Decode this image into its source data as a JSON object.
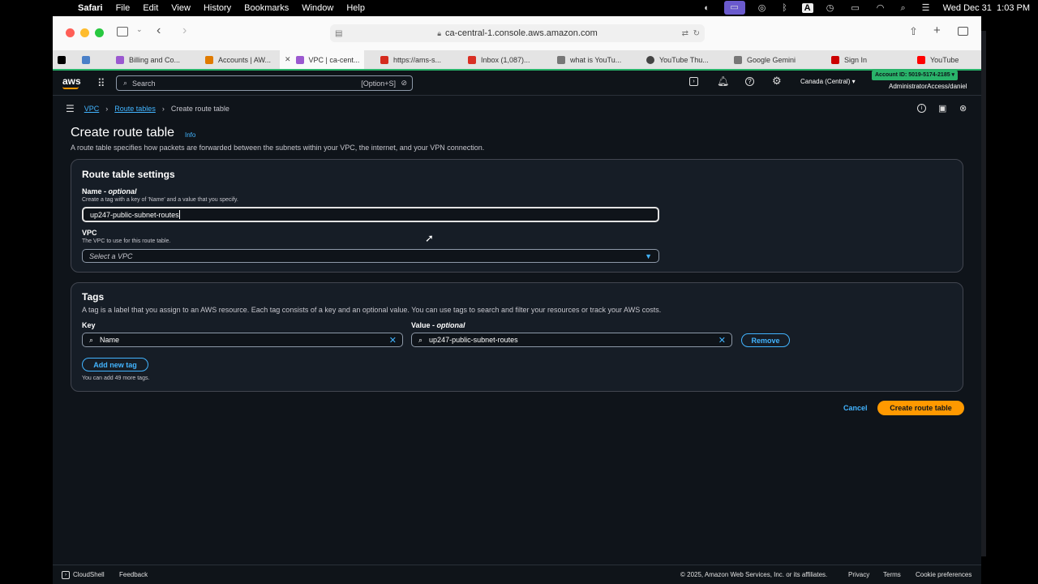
{
  "menubar": {
    "apple": "",
    "app": "Safari",
    "items": [
      "File",
      "Edit",
      "View",
      "History",
      "Bookmarks",
      "Window",
      "Help"
    ],
    "datetime": "Wed Dec 31  1:03 PM",
    "input_letter": "A"
  },
  "browser": {
    "url": "ca-central-1.console.aws.amazon.com",
    "tabs": [
      {
        "label": "",
        "color": "#000000"
      },
      {
        "label": "",
        "color": "#4a80c8"
      },
      {
        "label": "Billing and Co...",
        "color": "#9b59d0"
      },
      {
        "label": "Accounts | AW...",
        "color": "#e07b00"
      },
      {
        "label": "VPC | ca-cent...",
        "color": "#9b59d0"
      },
      {
        "label": "https://ams-s...",
        "color": "#d52b1e"
      },
      {
        "label": "Inbox (1,087)...",
        "color": "#d93025"
      },
      {
        "label": "what is YouTu...",
        "color": "#777777"
      },
      {
        "label": "YouTube Thu...",
        "color": "#444444"
      },
      {
        "label": "Google Gemini",
        "color": "#777777"
      },
      {
        "label": "Sign In",
        "color": "#cc0000"
      },
      {
        "label": "YouTube",
        "color": "#ff0000"
      }
    ]
  },
  "aws": {
    "logo": "aws",
    "search_placeholder": "Search",
    "search_shortcut": "[Option+S]",
    "region": "Canada (Central)",
    "account_id": "Account ID: 5019-5174-2185",
    "account_user": "AdministratorAccess/daniel"
  },
  "breadcrumb": [
    "VPC",
    "Route tables",
    "Create route table"
  ],
  "page": {
    "title": "Create route table",
    "info": "Info",
    "description": "A route table specifies how packets are forwarded between the subnets within your VPC, the internet, and your VPN connection."
  },
  "settings": {
    "heading": "Route table settings",
    "name_label": "Name - ",
    "name_optional": "optional",
    "name_hint": "Create a tag with a key of 'Name' and a value that you specify.",
    "name_value": "up247-public-subnet-routes",
    "vpc_label": "VPC",
    "vpc_hint": "The VPC to use for this route table.",
    "vpc_placeholder": "Select a VPC"
  },
  "tags": {
    "heading": "Tags",
    "description": "A tag is a label that you assign to an AWS resource. Each tag consists of a key and an optional value. You can use tags to search and filter your resources or track your AWS costs.",
    "key_label": "Key",
    "value_label": "Value - ",
    "value_optional": "optional",
    "key_value": "Name",
    "value_value": "up247-public-subnet-routes",
    "remove": "Remove",
    "add_tag": "Add new tag",
    "limit_note": "You can add 49 more tags."
  },
  "actions": {
    "cancel": "Cancel",
    "create": "Create route table"
  },
  "footer": {
    "cloudshell": "CloudShell",
    "feedback": "Feedback",
    "copyright": "© 2025, Amazon Web Services, Inc. or its affiliates.",
    "privacy": "Privacy",
    "terms": "Terms",
    "cookies": "Cookie preferences"
  },
  "colors": {
    "accent_blue": "#42b4ff",
    "primary_orange": "#ff9900",
    "account_badge": "#29b36a"
  }
}
